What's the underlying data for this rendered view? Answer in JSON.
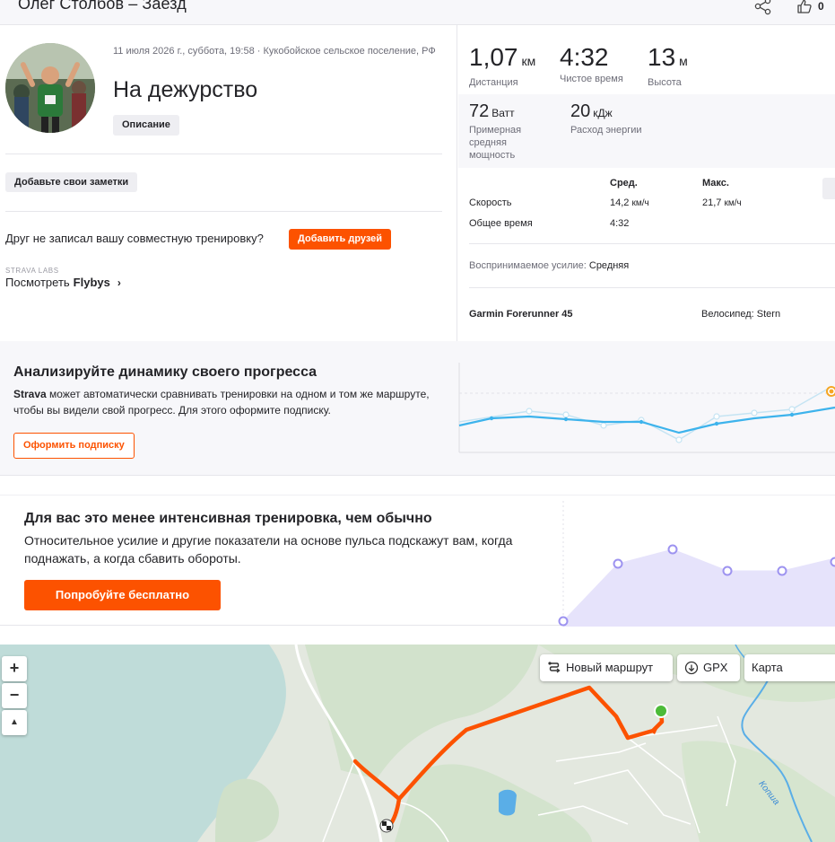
{
  "header": {
    "title": "Олег Столбов – Заезд",
    "kudos_count": "0"
  },
  "activity": {
    "meta": "11 июля 2026 г., суббота, 19:58 · Кукобойское сельское поселение, РФ",
    "title": "На дежурство",
    "description_button": "Описание",
    "notes_button": "Добавьте свои заметки",
    "friend_question": "Друг не записал вашу совместную тренировку?",
    "add_friends_button": "Добавить друзей",
    "labs_label": "STRAVA LABS",
    "flybys_prefix": "Посмотреть",
    "flybys_name": "Flybys",
    "flybys_chevron": "›"
  },
  "stats": {
    "distance": {
      "value": "1,07",
      "unit": "км",
      "label": "Дистанция"
    },
    "moving_time": {
      "value": "4:32",
      "label": "Чистое время"
    },
    "elevation": {
      "value": "13",
      "unit": "м",
      "label": "Высота"
    },
    "power": {
      "value": "72",
      "unit": "Ватт",
      "label": "Примерная средняя мощность"
    },
    "energy": {
      "value": "20",
      "unit": "кДж",
      "label": "Расход энергии"
    },
    "table": {
      "col_avg": "Сред.",
      "col_max": "Макс.",
      "rows": [
        {
          "label": "Скорость",
          "avg_value": "14,2",
          "avg_unit": "км/ч",
          "max_value": "21,7",
          "max_unit": "км/ч"
        },
        {
          "label": "Общее время",
          "avg_value": "4:32",
          "avg_unit": "",
          "max_value": "",
          "max_unit": ""
        }
      ]
    },
    "perceived_label": "Воспринимаемое усилие:",
    "perceived_value": "Средняя",
    "device": "Garmin Forerunner 45",
    "bike_label": "Велосипед:",
    "bike_value": "Stern"
  },
  "analysis": {
    "title": "Анализируйте динамику своего прогресса",
    "text_brand": "Strava",
    "text_rest": " может автоматически сравнивать тренировки на одном и том же маршруте, чтобы вы видели свой прогресс. Для этого оформите подписку.",
    "subscribe_button": "Оформить подписку"
  },
  "intensity": {
    "title": "Для вас это менее интенсивная тренировка, чем обычно",
    "text": "Относительное усилие и другие показатели на основе пульса подскажут вам, когда поднажать, а когда сбавить обороты.",
    "try_button": "Попробуйте бесплатно"
  },
  "map": {
    "new_route_button": "Новый маршрут",
    "gpx_button": "GPX",
    "map_type": "Карта",
    "zoom_in": "+",
    "zoom_out": "−",
    "compass": "▲",
    "river_label": "Копша"
  },
  "colors": {
    "accent": "#fc5200",
    "route": "#fc5200",
    "trend_line": "#3db3ec",
    "intensity_fill": "#e6e3fb",
    "intensity_point": "#9d93f0",
    "start": "#4cbb38"
  },
  "icons": {
    "share": "share-icon",
    "kudos": "thumbs-up-icon",
    "route": "route-icon",
    "download": "download-icon",
    "chevron": "chevron-right-icon"
  }
}
